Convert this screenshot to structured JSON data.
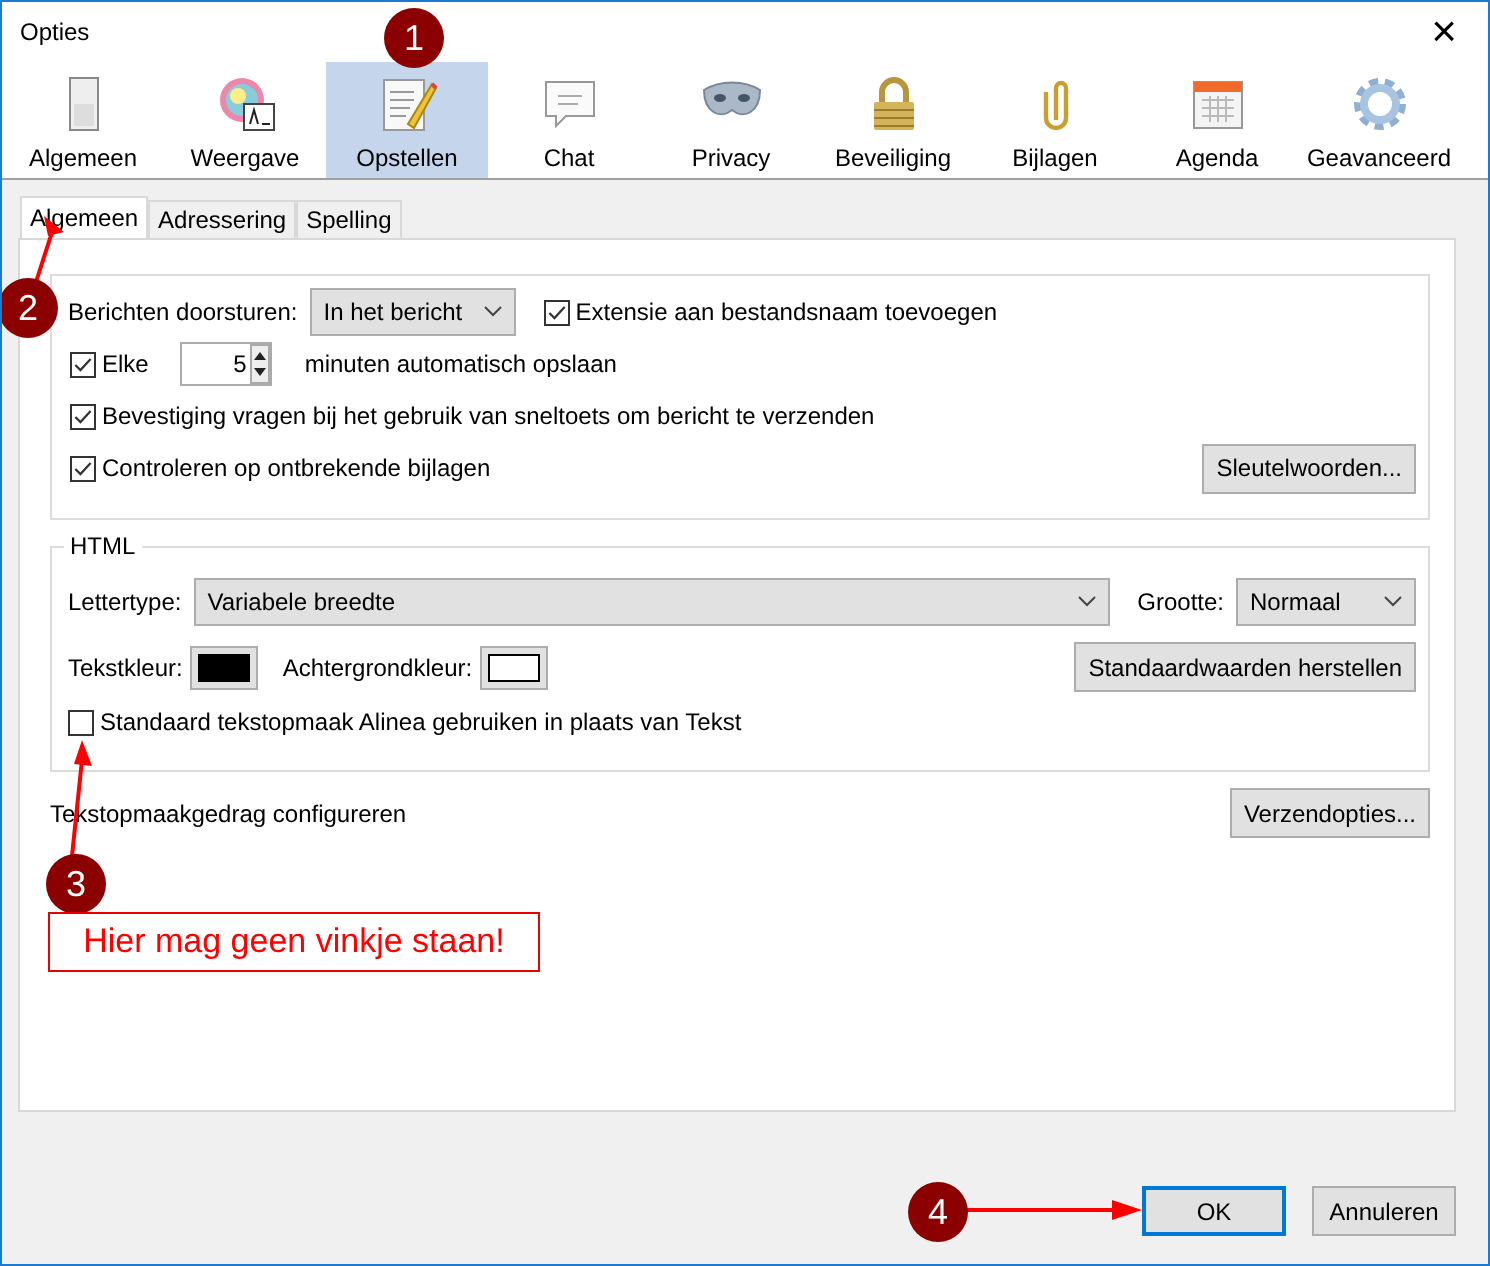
{
  "window": {
    "title": "Opties",
    "close": "×"
  },
  "toolbar": [
    {
      "label": "Algemeen",
      "selected": false
    },
    {
      "label": "Weergave",
      "selected": false
    },
    {
      "label": "Opstellen",
      "selected": true
    },
    {
      "label": "Chat",
      "selected": false
    },
    {
      "label": "Privacy",
      "selected": false
    },
    {
      "label": "Beveiliging",
      "selected": false
    },
    {
      "label": "Bijlagen",
      "selected": false
    },
    {
      "label": "Agenda",
      "selected": false
    },
    {
      "label": "Geavanceerd",
      "selected": false
    }
  ],
  "tabs": [
    {
      "label": "Algemeen",
      "selected": true
    },
    {
      "label": "Adressering",
      "selected": false
    },
    {
      "label": "Spelling",
      "selected": false
    }
  ],
  "general": {
    "forward_label": "Berichten doorsturen:",
    "forward_value": "In het bericht",
    "extension": {
      "label": "Extensie aan bestandsnaam toevoegen",
      "checked": true
    },
    "autosave": {
      "label": "Elke",
      "checked": true,
      "value": "5",
      "unit": "minuten automatisch opslaan"
    },
    "confirm": {
      "label": "Bevestiging vragen bij het gebruik van sneltoets om bericht te verzenden",
      "checked": true
    },
    "attachments": {
      "label": "Controleren op ontbrekende bijlagen",
      "checked": true
    },
    "keywords_button": "Sleutelwoorden..."
  },
  "html": {
    "title": "HTML",
    "font_label": "Lettertype:",
    "font_value": "Variabele breedte",
    "size_label": "Grootte:",
    "size_value": "Normaal",
    "colors": [
      {
        "label": "Tekstkleur:",
        "color": "#000000"
      },
      {
        "label": "Achtergrondkleur:",
        "color": "#ffffff"
      }
    ],
    "restore_button": "Standaardwaarden herstellen",
    "paragraph": {
      "label": "Standaard tekstopmaak Alinea gebruiken in plaats van Tekst",
      "checked": false
    }
  },
  "formatting": {
    "label": "Tekstopmaakgedrag configureren",
    "button": "Verzendopties..."
  },
  "annotations": [
    {
      "number": "1"
    },
    {
      "number": "2"
    },
    {
      "number": "3",
      "note": "Hier mag geen vinkje staan!"
    },
    {
      "number": "4"
    }
  ],
  "buttons": [
    {
      "label": "OK",
      "default": true
    },
    {
      "label": "Annuleren",
      "default": false
    }
  ]
}
